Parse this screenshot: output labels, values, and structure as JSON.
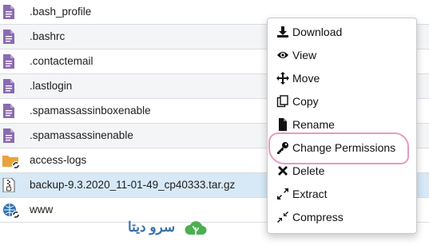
{
  "files": [
    {
      "name": ".bash_profile",
      "icon": "document-icon"
    },
    {
      "name": ".bashrc",
      "icon": "document-icon"
    },
    {
      "name": ".contactemail",
      "icon": "document-icon"
    },
    {
      "name": ".lastlogin",
      "icon": "document-icon"
    },
    {
      "name": ".spamassassinboxenable",
      "icon": "document-icon"
    },
    {
      "name": ".spamassassinenable",
      "icon": "document-icon"
    },
    {
      "name": "access-logs",
      "icon": "folder-link-icon"
    },
    {
      "name": "backup-9.3.2020_11-01-49_cp40333.tar.gz",
      "icon": "archive-icon"
    },
    {
      "name": "www",
      "icon": "globe-link-icon"
    }
  ],
  "context_menu": {
    "items": [
      {
        "label": "Download",
        "icon": "download-icon"
      },
      {
        "label": "View",
        "icon": "eye-icon"
      },
      {
        "label": "Move",
        "icon": "move-arrows-icon"
      },
      {
        "label": "Copy",
        "icon": "copy-icon"
      },
      {
        "label": "Rename",
        "icon": "file-icon"
      },
      {
        "label": "Change Permissions",
        "icon": "key-icon"
      },
      {
        "label": "Delete",
        "icon": "x-icon"
      },
      {
        "label": "Extract",
        "icon": "expand-icon"
      },
      {
        "label": "Compress",
        "icon": "compress-icon"
      }
    ]
  },
  "watermark": {
    "text": "سرو دیتا"
  },
  "colors": {
    "doc_icon": "#8a6bb1",
    "folder": "#e8a33c",
    "selected_row": "#d7e9f7",
    "alt_row": "#f4f5f7",
    "highlight_ring": "#e89ac0",
    "globe": "#2f6fb3",
    "watermark_green": "#4caf50",
    "watermark_blue": "#3a73a8"
  }
}
